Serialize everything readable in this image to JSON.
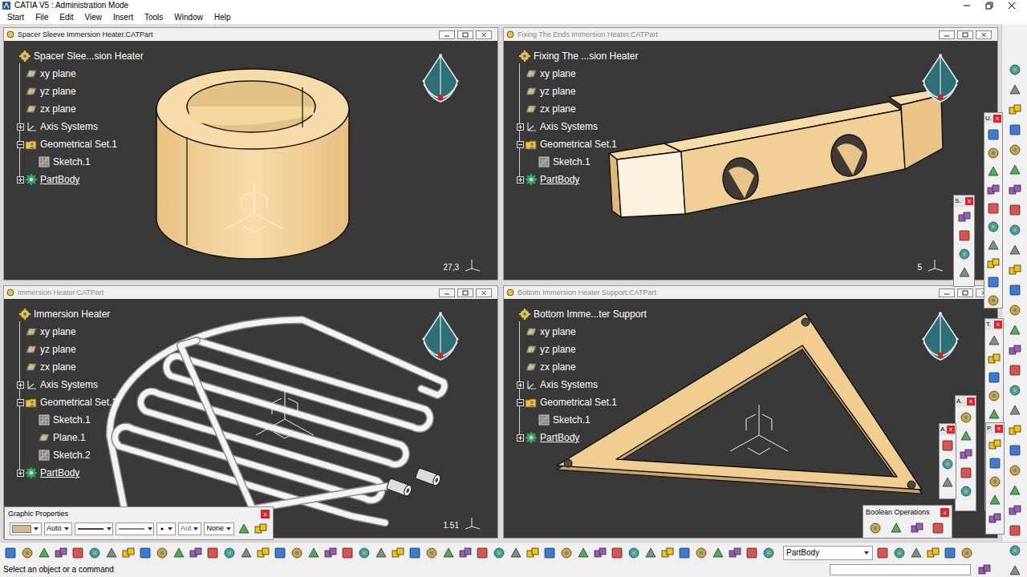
{
  "window": {
    "title": "CATIA V5 : Administration Mode"
  },
  "menu": [
    {
      "label": "Start"
    },
    {
      "label": "File"
    },
    {
      "label": "Edit"
    },
    {
      "label": "View"
    },
    {
      "label": "Insert"
    },
    {
      "label": "Tools"
    },
    {
      "label": "Window"
    },
    {
      "label": "Help"
    }
  ],
  "documents": [
    {
      "title": "Spacer Sleeve Immersion Heater.CATPart",
      "active": true,
      "model": "sleeve",
      "scale": "27,3",
      "tree": [
        {
          "label": "Spacer Slee...sion Heater",
          "kind": "part",
          "depth": 0,
          "in_work": false
        },
        {
          "label": "xy plane",
          "kind": "plane",
          "depth": 1,
          "in_work": false
        },
        {
          "label": "yz plane",
          "kind": "plane",
          "depth": 1,
          "in_work": false
        },
        {
          "label": "zx plane",
          "kind": "plane",
          "depth": 1,
          "in_work": false
        },
        {
          "label": "Axis Systems",
          "kind": "axis",
          "depth": 1,
          "expanded": false,
          "in_work": false
        },
        {
          "label": "Geometrical Set.1",
          "kind": "geoset",
          "depth": 1,
          "expanded": true,
          "in_work": false
        },
        {
          "label": "Sketch.1",
          "kind": "sketch",
          "depth": 2,
          "in_work": false
        },
        {
          "label": "PartBody",
          "kind": "body",
          "depth": 1,
          "expanded": false,
          "in_work": true
        }
      ]
    },
    {
      "title": "Fixing The Ends Immersion Heater.CATPart",
      "active": false,
      "model": "bar",
      "scale": "5",
      "tree": [
        {
          "label": "Fixing The ...sion Heater",
          "kind": "part",
          "depth": 0,
          "in_work": false
        },
        {
          "label": "xy plane",
          "kind": "plane",
          "depth": 1,
          "in_work": false
        },
        {
          "label": "yz plane",
          "kind": "plane",
          "depth": 1,
          "in_work": false
        },
        {
          "label": "zx plane",
          "kind": "plane",
          "depth": 1,
          "in_work": false
        },
        {
          "label": "Axis Systems",
          "kind": "axis",
          "depth": 1,
          "expanded": false,
          "in_work": false
        },
        {
          "label": "Geometrical Set.1",
          "kind": "geoset",
          "depth": 1,
          "expanded": true,
          "in_work": false
        },
        {
          "label": "Sketch.1",
          "kind": "sketch",
          "depth": 2,
          "in_work": false
        },
        {
          "label": "PartBody",
          "kind": "body",
          "depth": 1,
          "expanded": false,
          "in_work": true
        }
      ]
    },
    {
      "title": "Immersion Heater.CATPart",
      "active": false,
      "model": "coil",
      "scale": "1.51",
      "tree": [
        {
          "label": "Immersion Heater",
          "kind": "part",
          "depth": 0,
          "in_work": false
        },
        {
          "label": "xy plane",
          "kind": "plane",
          "depth": 1,
          "in_work": false
        },
        {
          "label": "yz plane",
          "kind": "plane",
          "depth": 1,
          "in_work": false
        },
        {
          "label": "zx plane",
          "kind": "plane",
          "depth": 1,
          "in_work": false
        },
        {
          "label": "Axis Systems",
          "kind": "axis",
          "depth": 1,
          "expanded": false,
          "in_work": false
        },
        {
          "label": "Geometrical Set.1",
          "kind": "geoset",
          "depth": 1,
          "expanded": true,
          "in_work": false
        },
        {
          "label": "Sketch.1",
          "kind": "sketch",
          "depth": 2,
          "in_work": false
        },
        {
          "label": "Plane.1",
          "kind": "plane",
          "depth": 2,
          "in_work": false
        },
        {
          "label": "Sketch.2",
          "kind": "sketch",
          "depth": 2,
          "in_work": false
        },
        {
          "label": "PartBody",
          "kind": "body",
          "depth": 1,
          "expanded": false,
          "in_work": true
        }
      ]
    },
    {
      "title": "Bottom Immersion Heater Support.CATPart",
      "active": false,
      "model": "triangle",
      "tree": [
        {
          "label": "Bottom Imme...ter Support",
          "kind": "part",
          "depth": 0,
          "in_work": false
        },
        {
          "label": "xy plane",
          "kind": "plane",
          "depth": 1,
          "in_work": false
        },
        {
          "label": "yz plane",
          "kind": "plane",
          "depth": 1,
          "in_work": false
        },
        {
          "label": "zx plane",
          "kind": "plane",
          "depth": 1,
          "in_work": false
        },
        {
          "label": "Axis Systems",
          "kind": "axis",
          "depth": 1,
          "expanded": false,
          "in_work": false
        },
        {
          "label": "Geometrical Set.1",
          "kind": "geoset",
          "depth": 1,
          "expanded": true,
          "in_work": false
        },
        {
          "label": "Sketch.1",
          "kind": "sketch",
          "depth": 2,
          "in_work": false
        },
        {
          "label": "PartBody",
          "kind": "body",
          "depth": 1,
          "expanded": false,
          "in_work": true
        }
      ]
    }
  ],
  "floating_toolbars": [
    {
      "title": "U.",
      "close": "x"
    },
    {
      "title": "S.",
      "close": "x"
    },
    {
      "title": "T.",
      "close": "x"
    },
    {
      "title": "A.",
      "close": "x"
    },
    {
      "title": "A.",
      "close": "x"
    },
    {
      "title": "P.",
      "close": "x"
    }
  ],
  "graphic_properties": {
    "title": "Graphic Properties",
    "close": "x",
    "transparency": "Auto",
    "thickness": "Aut",
    "layer": "None"
  },
  "boolean_operations": {
    "title": "Boolean Operations",
    "close": "x"
  },
  "bottom_toolbar": {
    "current_body": "PartBody"
  },
  "status_bar": {
    "message": "Select an object or a command"
  }
}
